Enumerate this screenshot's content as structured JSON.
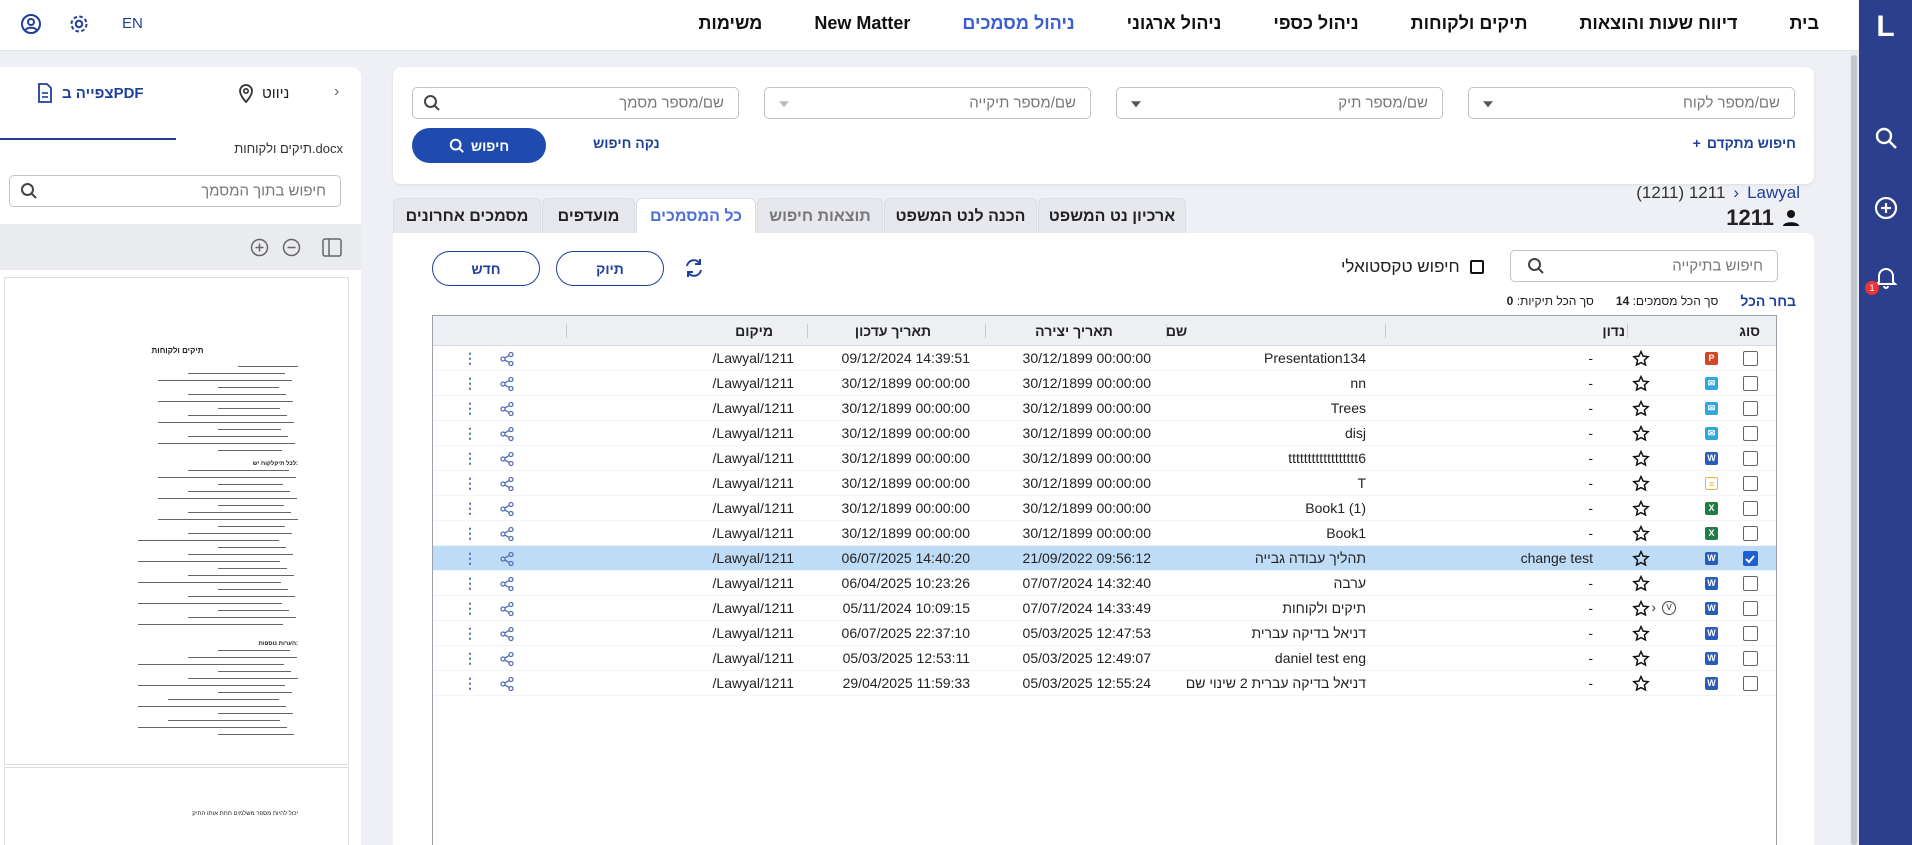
{
  "nav": {
    "lang": "EN",
    "items": [
      "בית",
      "דיווח שעות והוצאות",
      "תיקים ולקוחות",
      "ניהול כספי",
      "ניהול ארגוני",
      "ניהול מסמכים",
      "New Matter",
      "משימות"
    ],
    "active_index": 5
  },
  "rail": {
    "logo": "L",
    "notification_count": "1"
  },
  "left_panel": {
    "tab_pdf": "צפייה בPDF",
    "tab_nav": "ניווט",
    "file_name": "תיקים ולקוחות.docx",
    "search_placeholder": "חיפוש בתוך המסמך",
    "preview": {
      "title": "תיקים ולקוחות",
      "subheading": "לכל תיקלקוח יש:",
      "section2": "הערות נוספות:",
      "page2_text": "יכול להיות מספר משלמים תחת אותו התיק"
    }
  },
  "filters": {
    "client_placeholder": "שם/מספר לקוח",
    "case_placeholder": "שם/מספר תיק",
    "folder_placeholder": "שם/מספר תיקייה",
    "doc_placeholder": "שם/מספר מסמך",
    "advanced": "חיפוש מתקדם",
    "clear": "נקה חיפוש",
    "search": "חיפוש"
  },
  "breadcrumb": {
    "root": "Lawyal",
    "current": "1211 (1211)"
  },
  "page_title": "1211",
  "tabs": [
    "מסמכים אחרונים",
    "מועדפים",
    "כל המסמכים",
    "תוצאות חיפוש",
    "הכנה לנט המשפט",
    "ארכיון נט המשפט"
  ],
  "active_tab": 2,
  "doc_toolbar": {
    "folder_search_placeholder": "חיפוש בתיקייה",
    "textual_search": "חיפוש טקסטואלי",
    "new_button": "חדש",
    "tag_button": "תיוק",
    "select_all": "בחר הכל",
    "docs_total_label": "סך הכל מסמכים:",
    "docs_total": "14",
    "folders_total_label": "סך הכל תיקיות:",
    "folders_total": "0"
  },
  "table": {
    "headers": {
      "type": "סוג",
      "discussed": "נדון",
      "name": "שם",
      "created": "תאריך יצירה",
      "updated": "תאריך עדכון",
      "location": "מיקום"
    },
    "rows": [
      {
        "type": "P",
        "color": "#d24726",
        "discussed": "-",
        "name": "Presentation134",
        "created": "30/12/1899 00:00:00",
        "updated": "09/12/2024 14:39:51",
        "location": "/Lawyal/1211",
        "selected": false,
        "version": false,
        "expand": false
      },
      {
        "type": "✉",
        "color": "#2fa8e0",
        "discussed": "-",
        "name": "nn",
        "created": "30/12/1899 00:00:00",
        "updated": "30/12/1899 00:00:00",
        "location": "/Lawyal/1211",
        "selected": false,
        "version": false,
        "expand": false
      },
      {
        "type": "✉",
        "color": "#2fa8e0",
        "discussed": "-",
        "name": "Trees",
        "created": "30/12/1899 00:00:00",
        "updated": "30/12/1899 00:00:00",
        "location": "/Lawyal/1211",
        "selected": false,
        "version": false,
        "expand": false
      },
      {
        "type": "✉",
        "color": "#2fa8e0",
        "discussed": "-",
        "name": "disj",
        "created": "30/12/1899 00:00:00",
        "updated": "30/12/1899 00:00:00",
        "location": "/Lawyal/1211",
        "selected": false,
        "version": false,
        "expand": false
      },
      {
        "type": "W",
        "color": "#2b5cb8",
        "discussed": "-",
        "name": "tttttttttttttttttt6",
        "created": "30/12/1899 00:00:00",
        "updated": "30/12/1899 00:00:00",
        "location": "/Lawyal/1211",
        "selected": false,
        "version": false,
        "expand": false
      },
      {
        "type": "≡",
        "color": "#f0b030",
        "discussed": "-",
        "name": "T",
        "created": "30/12/1899 00:00:00",
        "updated": "30/12/1899 00:00:00",
        "location": "/Lawyal/1211",
        "selected": false,
        "version": false,
        "expand": false
      },
      {
        "type": "X",
        "color": "#1e7e45",
        "discussed": "-",
        "name": "Book1 (1)",
        "created": "30/12/1899 00:00:00",
        "updated": "30/12/1899 00:00:00",
        "location": "/Lawyal/1211",
        "selected": false,
        "version": false,
        "expand": false
      },
      {
        "type": "X",
        "color": "#1e7e45",
        "discussed": "-",
        "name": "Book1",
        "created": "30/12/1899 00:00:00",
        "updated": "30/12/1899 00:00:00",
        "location": "/Lawyal/1211",
        "selected": false,
        "version": false,
        "expand": false
      },
      {
        "type": "W",
        "color": "#2b5cb8",
        "discussed": "change test",
        "name": "תהליך עבודה גבייה",
        "created": "21/09/2022 09:56:12",
        "updated": "06/07/2025 14:40:20",
        "location": "/Lawyal/1211",
        "selected": true,
        "version": false,
        "expand": false
      },
      {
        "type": "W",
        "color": "#2b5cb8",
        "discussed": "-",
        "name": "ערבה",
        "created": "07/07/2024 14:32:40",
        "updated": "06/04/2025 10:23:26",
        "location": "/Lawyal/1211",
        "selected": false,
        "version": false,
        "expand": false
      },
      {
        "type": "W",
        "color": "#2b5cb8",
        "discussed": "-",
        "name": "תיקים ולקוחות",
        "created": "07/07/2024 14:33:49",
        "updated": "05/11/2024 10:09:15",
        "location": "/Lawyal/1211",
        "selected": false,
        "version": true,
        "expand": true
      },
      {
        "type": "W",
        "color": "#2b5cb8",
        "discussed": "-",
        "name": "דניאל בדיקה עברית",
        "created": "05/03/2025 12:47:53",
        "updated": "06/07/2025 22:37:10",
        "location": "/Lawyal/1211",
        "selected": false,
        "version": false,
        "expand": false
      },
      {
        "type": "W",
        "color": "#2b5cb8",
        "discussed": "-",
        "name": "daniel test eng",
        "created": "05/03/2025 12:49:07",
        "updated": "05/03/2025 12:53:11",
        "location": "/Lawyal/1211",
        "selected": false,
        "version": false,
        "expand": false
      },
      {
        "type": "W",
        "color": "#2b5cb8",
        "discussed": "-",
        "name": "דניאל בדיקה עברית 2 שינוי שם",
        "created": "05/03/2025 12:55:24",
        "updated": "29/04/2025 11:59:33",
        "location": "/Lawyal/1211",
        "selected": false,
        "version": false,
        "expand": false
      }
    ]
  },
  "colors": {
    "brand": "#2b3f8c",
    "primary": "#1f4aae",
    "active_tab": "#4a6fd8",
    "selected_row": "#bfdcf7"
  }
}
